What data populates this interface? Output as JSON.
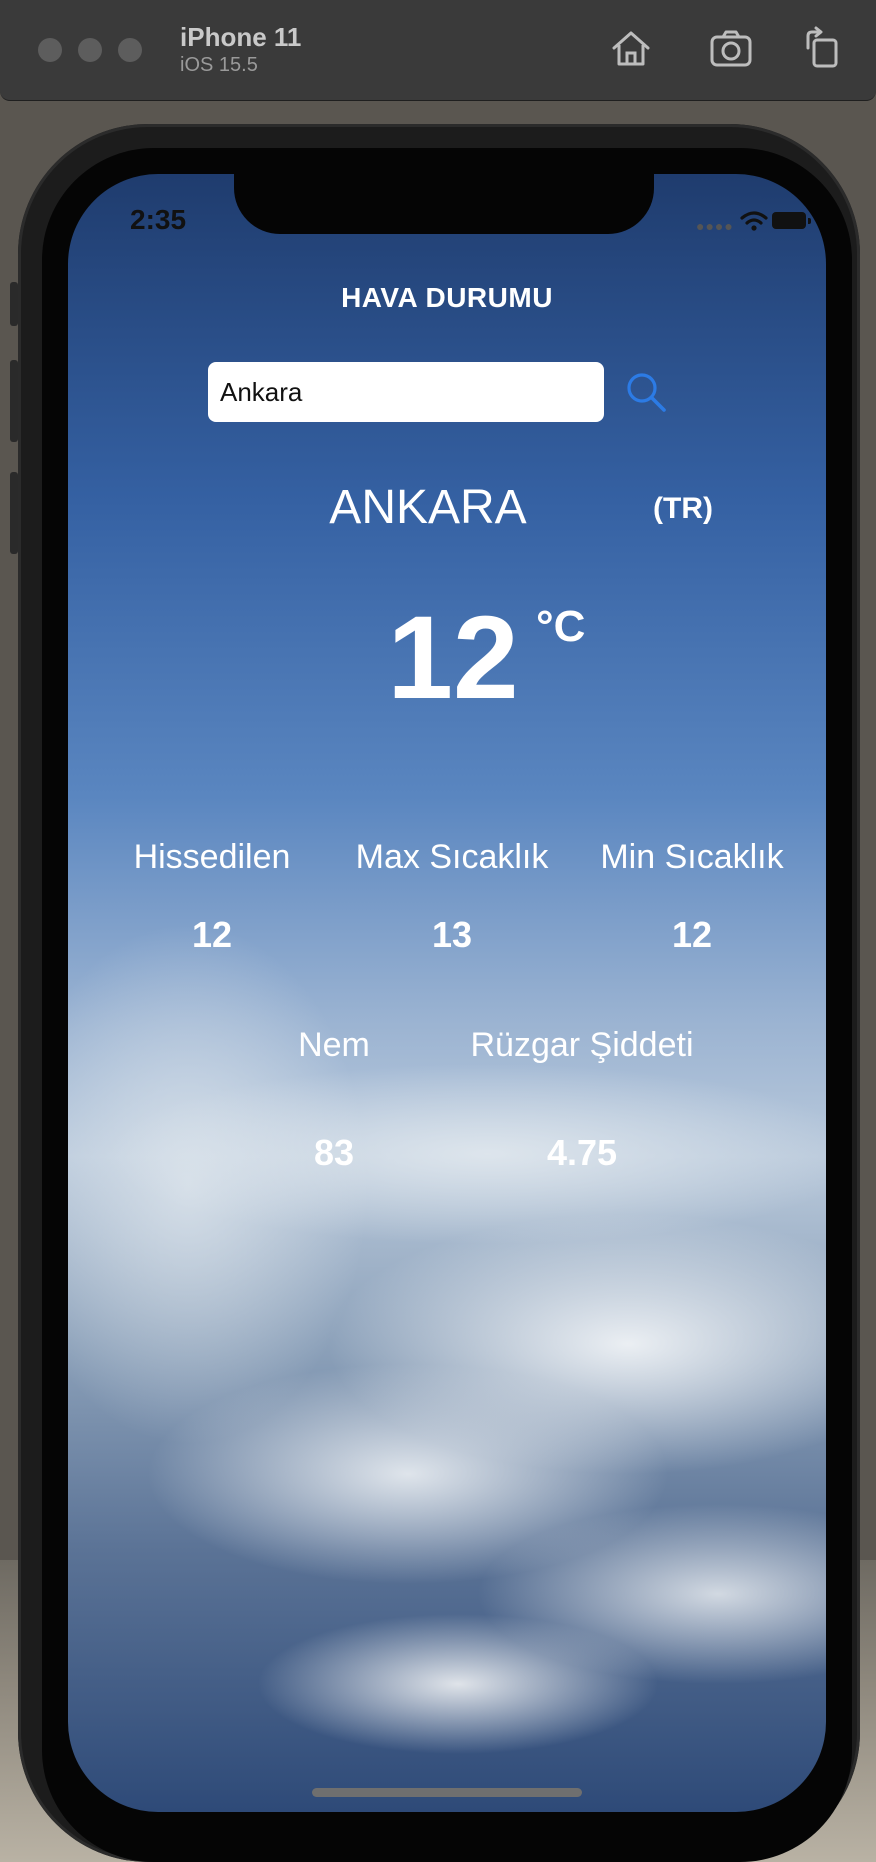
{
  "simulator": {
    "device_name": "iPhone 11",
    "os_version": "iOS 15.5"
  },
  "status_bar": {
    "time": "2:35"
  },
  "app": {
    "title": "HAVA DURUMU",
    "search": {
      "value": "Ankara"
    },
    "city": "ANKARA",
    "country": "(TR)",
    "temperature": "12",
    "temperature_unit": "°C",
    "stats": {
      "feels_like": {
        "label": "Hissedilen",
        "value": "12"
      },
      "max_temp": {
        "label": "Max Sıcaklık",
        "value": "13"
      },
      "min_temp": {
        "label": "Min Sıcaklık",
        "value": "12"
      },
      "humidity": {
        "label": "Nem",
        "value": "83"
      },
      "wind": {
        "label": "Rüzgar Şiddeti",
        "value": "4.75"
      }
    }
  },
  "colors": {
    "accent": "#2c7be5",
    "text": "#ffffff"
  },
  "icons": {
    "search": "search-icon",
    "home": "home-icon",
    "screenshot": "camera-icon",
    "rotate": "rotate-icon",
    "wifi": "wifi-icon",
    "battery": "battery-icon"
  }
}
